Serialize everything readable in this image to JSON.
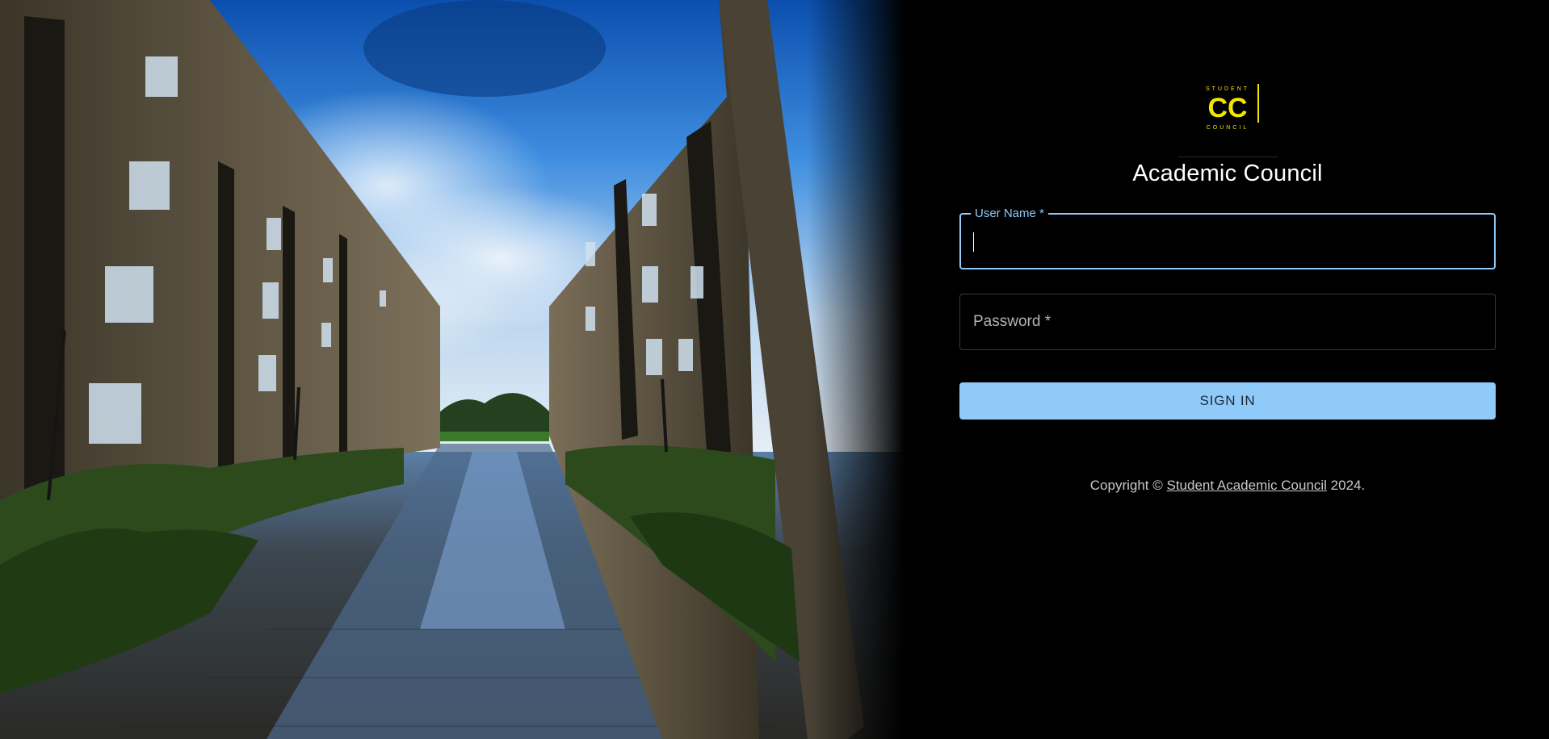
{
  "app": {
    "title": "Academic Council",
    "logo_top_text": "STUDENT",
    "logo_bottom_text": "COUNCIL",
    "logo_mark": "CC"
  },
  "form": {
    "username_label": "User Name *",
    "username_value": "",
    "password_label": "Password *",
    "password_value": "",
    "submit_label": "SIGN IN"
  },
  "footer": {
    "prefix": "Copyright © ",
    "link_text": "Student Academic Council",
    "suffix": " 2024."
  },
  "colors": {
    "accent": "#90caf9",
    "logo_yellow": "#f3e600",
    "background": "#000000"
  },
  "icons": {
    "logo": "student-council-logo"
  }
}
